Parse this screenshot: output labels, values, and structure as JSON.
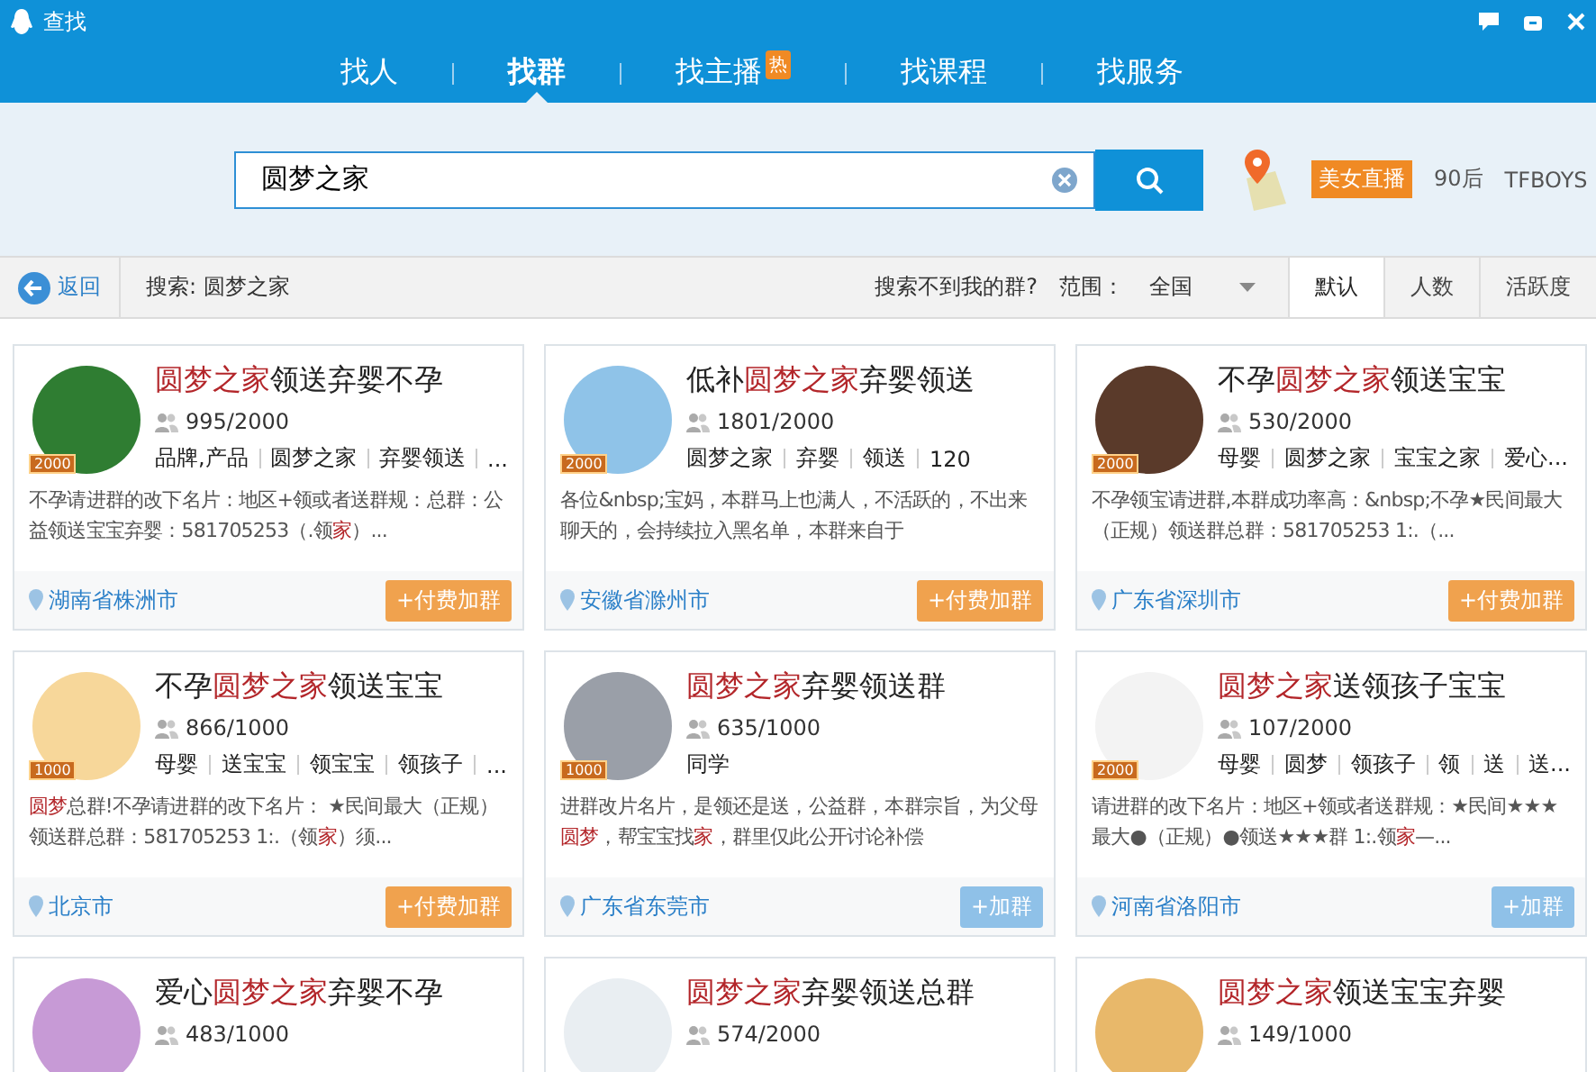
{
  "window": {
    "title": "查找"
  },
  "tabs": [
    {
      "label": "找人",
      "selected": false
    },
    {
      "label": "找群",
      "selected": true
    },
    {
      "label": "找主播",
      "selected": false,
      "badge": "热"
    },
    {
      "label": "找课程",
      "selected": false
    },
    {
      "label": "找服务",
      "selected": false
    }
  ],
  "search": {
    "value": "圆梦之家"
  },
  "hot_tags": [
    {
      "label": "美女直播",
      "kind": "highlight"
    },
    {
      "label": "90后",
      "kind": "plain"
    },
    {
      "label": "TFBOYS",
      "kind": "plain"
    }
  ],
  "filter_bar": {
    "back": "返回",
    "query": "搜索: 圆梦之家",
    "help_link": "搜索不到我的群?",
    "range_label": "范围：",
    "range_value": "全国",
    "sorts": [
      {
        "label": "默认",
        "selected": true
      },
      {
        "label": "人数",
        "selected": false
      },
      {
        "label": "活跃度",
        "selected": false
      }
    ]
  },
  "groups": [
    {
      "title": "**圆梦之家**领送弃婴不孕",
      "level": "2000",
      "members": "995/2000",
      "tags": [
        "品牌,产品",
        "圆梦之家",
        "弃婴领送",
        "..."
      ],
      "description": "不孕请进群的改下名片：地区+领或者送群规：总群：公益领送宝宝弃婴：581705253（.领**家**）...",
      "location": "湖南省株洲市",
      "join": {
        "label": "+付费加群",
        "kind": "paid"
      }
    },
    {
      "title": "低补**圆梦之家**弃婴领送",
      "level": "2000",
      "members": "1801/2000",
      "tags": [
        "圆梦之家",
        "弃婴",
        "领送",
        "120"
      ],
      "description": "各位&nbsp;宝妈，本群马上也满人，不活跃的，不出来聊天的，会持续拉入黑名单，本群来自于",
      "location": "安徽省滁州市",
      "join": {
        "label": "+付费加群",
        "kind": "paid"
      }
    },
    {
      "title": "不孕**圆梦之家**领送宝宝",
      "level": "2000",
      "members": "530/2000",
      "tags": [
        "母婴",
        "圆梦之家",
        "宝宝之家",
        "爱心..."
      ],
      "description": "不孕领宝请进群,本群成功率高：&nbsp;不孕★民间最大（正规）领送群总群：581705253 1:.（...",
      "location": "广东省深圳市",
      "join": {
        "label": "+付费加群",
        "kind": "paid"
      }
    },
    {
      "title": "不孕**圆梦之家**领送宝宝",
      "level": "1000",
      "members": "866/1000",
      "tags": [
        "母婴",
        "送宝宝",
        "领宝宝",
        "领孩子",
        "..."
      ],
      "description": "**圆梦**总群!不孕请进群的改下名片： ★民间最大（正规）领送群总群：581705253 1:.（领**家**）须...",
      "location": "北京市",
      "join": {
        "label": "+付费加群",
        "kind": "paid"
      }
    },
    {
      "title": "**圆梦之家**弃婴领送群",
      "level": "1000",
      "members": "635/1000",
      "tags": [
        "同学"
      ],
      "description": "进群改片名片，是领还是送，公益群，本群宗旨，为父母**圆梦**，帮宝宝找**家**，群里仅此公开讨论补偿",
      "location": "广东省东莞市",
      "join": {
        "label": "+加群",
        "kind": "free"
      }
    },
    {
      "title": "**圆梦之家**送领孩子宝宝",
      "level": "2000",
      "members": "107/2000",
      "tags": [
        "母婴",
        "圆梦",
        "领孩子",
        "领",
        "送",
        "送..."
      ],
      "description": "请进群的改下名片：地区+领或者送群规：★民间★★★最大●（正规）●领送★★★群 1:.领**家**—...",
      "location": "河南省洛阳市",
      "join": {
        "label": "+加群",
        "kind": "free"
      }
    },
    {
      "title": "爱心**圆梦之家**弃婴不孕",
      "members": "483/1000"
    },
    {
      "title": "**圆梦之家**弃婴领送总群",
      "members": "574/2000"
    },
    {
      "title": "**圆梦之家**领送宝宝弃婴",
      "members": "149/1000"
    }
  ]
}
